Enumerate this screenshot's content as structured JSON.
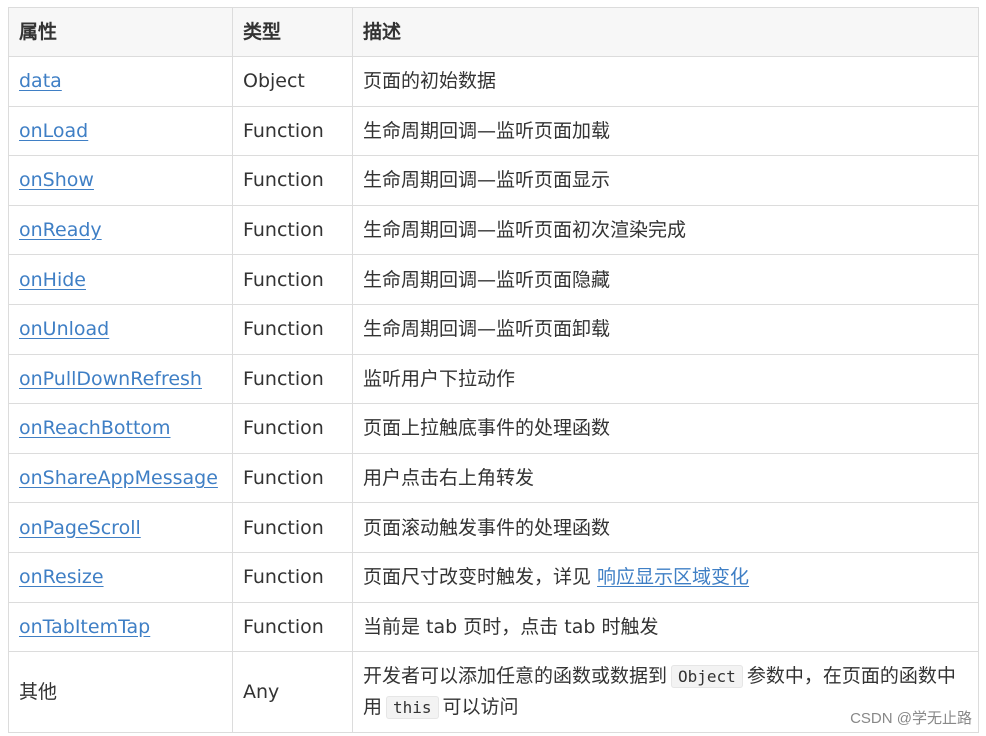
{
  "table": {
    "headers": [
      "属性",
      "类型",
      "描述"
    ],
    "rows": [
      {
        "attr": "data",
        "type": "Object",
        "desc": "页面的初始数据"
      },
      {
        "attr": "onLoad",
        "type": "Function",
        "desc": "生命周期回调—监听页面加载"
      },
      {
        "attr": "onShow",
        "type": "Function",
        "desc": "生命周期回调—监听页面显示"
      },
      {
        "attr": "onReady",
        "type": "Function",
        "desc": "生命周期回调—监听页面初次渲染完成"
      },
      {
        "attr": "onHide",
        "type": "Function",
        "desc": "生命周期回调—监听页面隐藏"
      },
      {
        "attr": "onUnload",
        "type": "Function",
        "desc": "生命周期回调—监听页面卸载"
      },
      {
        "attr": "onPullDownRefresh",
        "type": "Function",
        "desc": "监听用户下拉动作"
      },
      {
        "attr": "onReachBottom",
        "type": "Function",
        "desc": "页面上拉触底事件的处理函数"
      },
      {
        "attr": "onShareAppMessage",
        "type": "Function",
        "desc": "用户点击右上角转发"
      },
      {
        "attr": "onPageScroll",
        "type": "Function",
        "desc": "页面滚动触发事件的处理函数"
      },
      {
        "attr": "onResize",
        "type": "Function",
        "desc_text": "页面尺寸改变时触发，详见 ",
        "desc_link": "响应显示区域变化"
      },
      {
        "attr": "onTabItemTap",
        "type": "Function",
        "desc": "当前是 tab 页时，点击 tab 时触发"
      },
      {
        "attr": "其他",
        "type": "Any",
        "desc_p1": "开发者可以添加任意的函数或数据到",
        "desc_code1": "Object",
        "desc_p2": "参数中，在页面的函数中用",
        "desc_code2": "this",
        "desc_p3": "可以访问"
      }
    ]
  },
  "watermark": "CSDN @学无止路"
}
